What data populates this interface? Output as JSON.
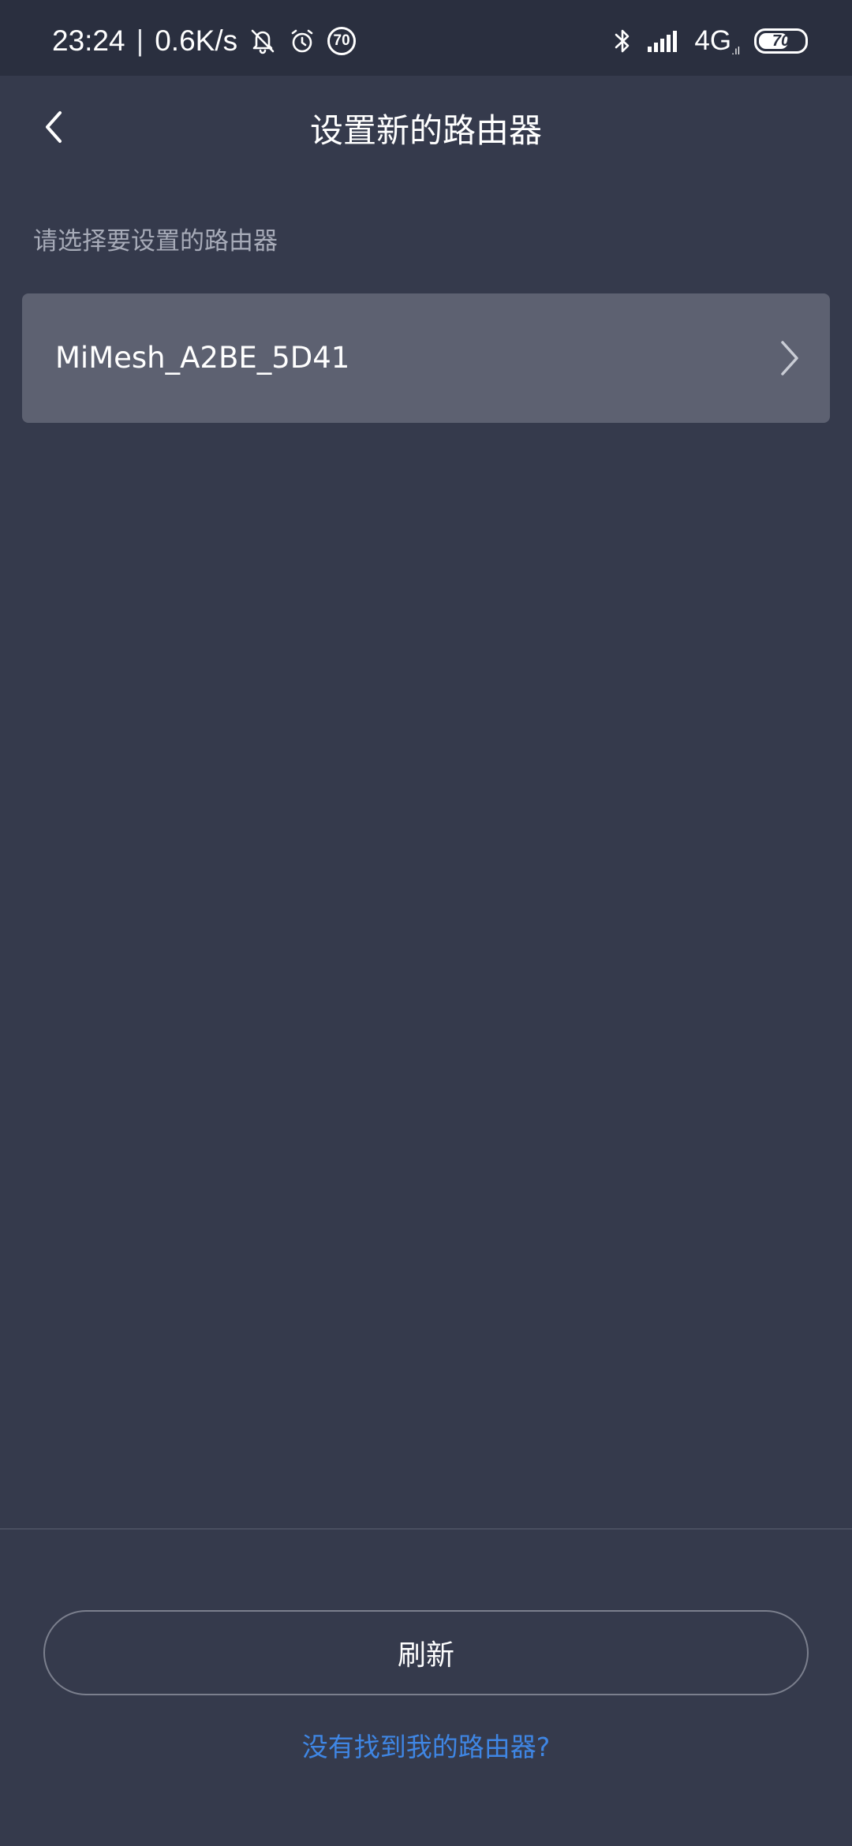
{
  "status_bar": {
    "time": "23:24",
    "separator": "|",
    "net_speed": "0.6K/s",
    "notification_badge": "70",
    "network_type": "4G",
    "network_suffix": ".ıl",
    "battery_level": "70",
    "battery_fraction": 0.7,
    "icons": [
      "mute-bell-icon",
      "alarm-icon",
      "badge-70-icon",
      "bluetooth-icon",
      "signal-icon",
      "battery-icon"
    ]
  },
  "header": {
    "title": "设置新的路由器",
    "back_icon": "chevron-left-icon"
  },
  "main": {
    "hint": "请选择要设置的路由器",
    "routers": [
      {
        "name": "MiMesh_A2BE_5D41",
        "icon": "chevron-right-icon"
      }
    ]
  },
  "footer": {
    "refresh_label": "刷新",
    "not_found_link": "没有找到我的路由器?"
  },
  "colors": {
    "background": "#353a4c",
    "status_bar": "#2a2f3f",
    "list_item": "#5d6171",
    "link": "#3f86e4",
    "hint_text": "#a7abb8"
  }
}
